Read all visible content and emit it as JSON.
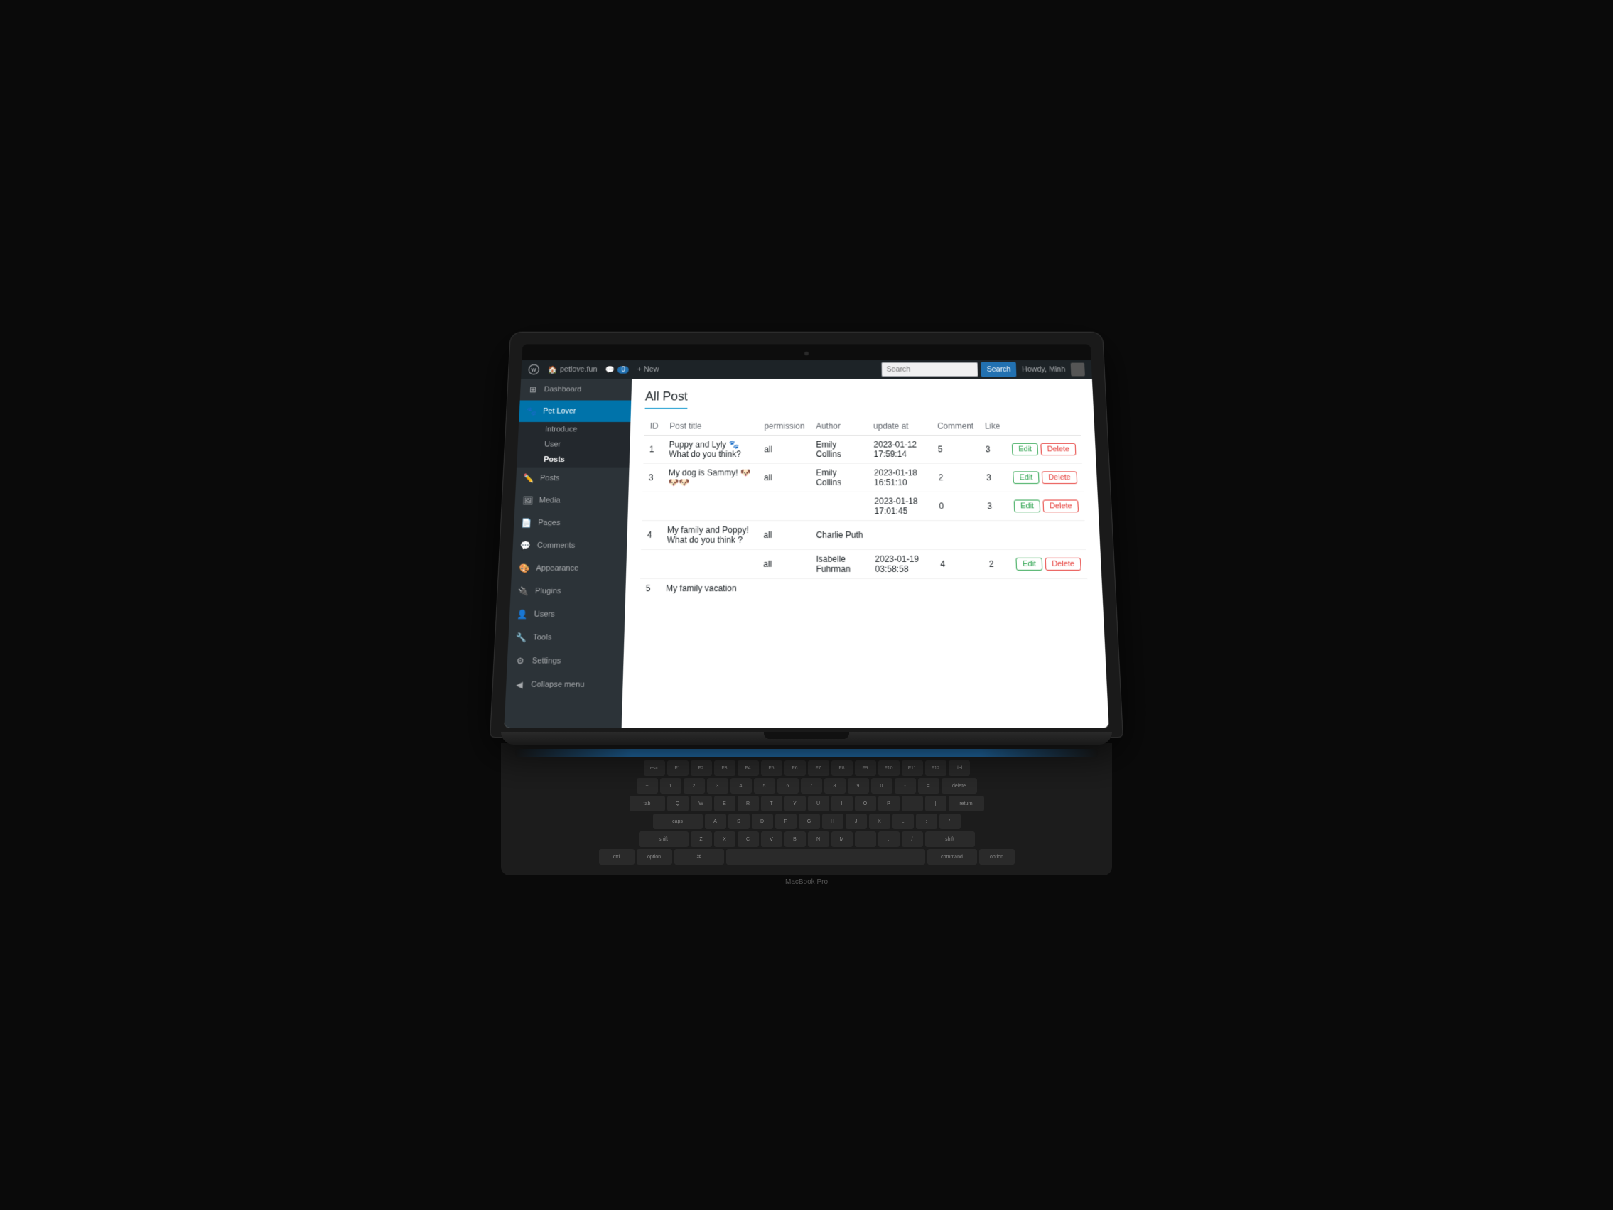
{
  "adminBar": {
    "siteName": "petlove.fun",
    "comments": "0",
    "newLabel": "+ New",
    "howdy": "Howdy, Minh",
    "searchPlaceholder": "Search",
    "searchButtonLabel": "Search"
  },
  "sidebar": {
    "logo": "WP",
    "items": [
      {
        "id": "dashboard",
        "label": "Dashboard",
        "icon": "⊞"
      },
      {
        "id": "pet-lover",
        "label": "Pet Lover",
        "icon": "🐾",
        "active": true
      },
      {
        "id": "introduce",
        "label": "Introduce",
        "sub": true
      },
      {
        "id": "user",
        "label": "User",
        "sub": true
      },
      {
        "id": "posts-header",
        "label": "Posts",
        "sub": true,
        "bold": true
      },
      {
        "id": "posts",
        "label": "Posts",
        "icon": "✏️"
      },
      {
        "id": "media",
        "label": "Media",
        "icon": "🖼"
      },
      {
        "id": "pages",
        "label": "Pages",
        "icon": "📄"
      },
      {
        "id": "comments",
        "label": "Comments",
        "icon": "💬"
      },
      {
        "id": "appearance",
        "label": "Appearance",
        "icon": "🎨"
      },
      {
        "id": "plugins",
        "label": "Plugins",
        "icon": "🔌"
      },
      {
        "id": "users",
        "label": "Users",
        "icon": "👤"
      },
      {
        "id": "tools",
        "label": "Tools",
        "icon": "🔧"
      },
      {
        "id": "settings",
        "label": "Settings",
        "icon": "⚙"
      },
      {
        "id": "collapse",
        "label": "Collapse menu",
        "icon": "◀"
      }
    ]
  },
  "content": {
    "pageTitle": "All Post",
    "tableHeaders": {
      "id": "ID",
      "postTitle": "Post title",
      "permission": "permission",
      "author": "Author",
      "updateAt": "update at",
      "comment": "Comment",
      "like": "Like",
      "editLabel": "Edit",
      "deleteLabel": "Delete"
    },
    "posts": [
      {
        "id": "1",
        "title": "Puppy and Lyly 🐾 What do you think?",
        "permission": "all",
        "author": "Emily Collins",
        "updatedAt": "2023-01-12 17:59:14",
        "comment": "5",
        "like": "3",
        "hasActions": true
      },
      {
        "id": "3",
        "title": "My dog is Sammy! 🐶🐶🐶",
        "permission": "all",
        "author": "Emily Collins",
        "updatedAt": "2023-01-18 16:51:10",
        "comment": "2",
        "like": "3",
        "hasActions": true
      },
      {
        "id": "",
        "title": "",
        "permission": "",
        "author": "",
        "updatedAt": "2023-01-18 17:01:45",
        "comment": "0",
        "like": "3",
        "hasActions": true
      },
      {
        "id": "4",
        "title": "My family and Poppy! What do you think ?",
        "permission": "all",
        "author": "Charlie Puth",
        "updatedAt": "",
        "comment": "",
        "like": "",
        "hasActions": false
      },
      {
        "id": "",
        "title": "",
        "permission": "all",
        "author": "Isabelle Fuhrman",
        "updatedAt": "2023-01-19 03:58:58",
        "comment": "4",
        "like": "2",
        "hasActions": true
      },
      {
        "id": "5",
        "title": "My family vacation",
        "permission": "",
        "author": "",
        "updatedAt": "",
        "comment": "",
        "like": "",
        "hasActions": false
      }
    ]
  },
  "laptop": {
    "brand": "MacBook Pro"
  }
}
